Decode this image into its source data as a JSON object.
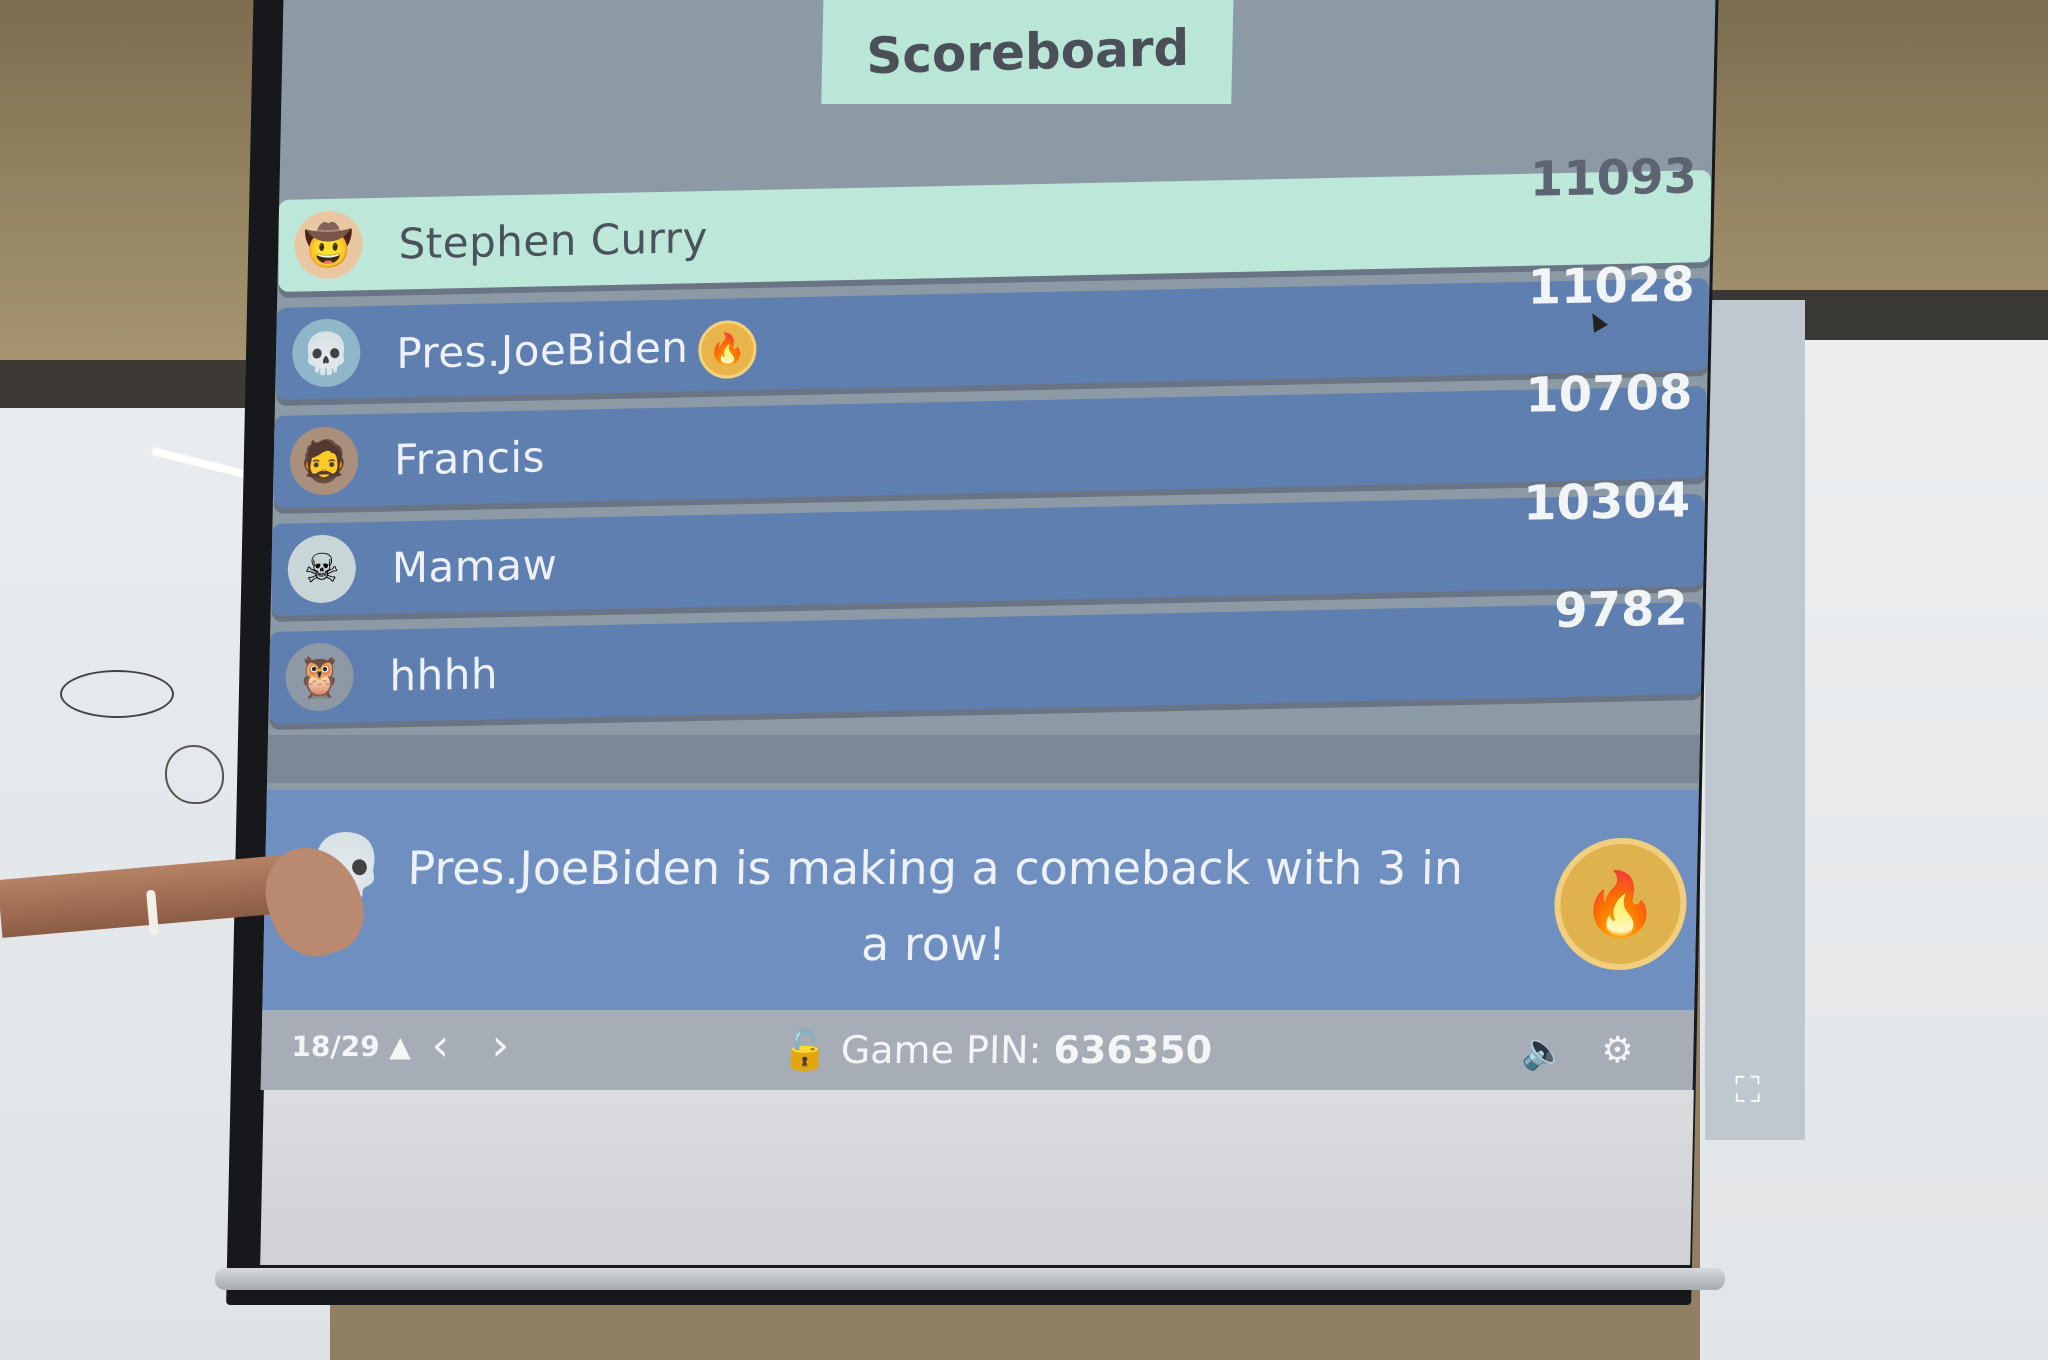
{
  "app": {
    "title": "Scoreboard"
  },
  "scoreboard": {
    "rows": [
      {
        "name": "Stephen Curry",
        "score": "11093",
        "avatar": "sombrero-emoji",
        "streak": false
      },
      {
        "name": "Pres.JoeBiden",
        "score": "11028",
        "avatar": "skull-tophat-emoji",
        "streak": true
      },
      {
        "name": "Francis",
        "score": "10708",
        "avatar": "bearded-face-emoji",
        "streak": false
      },
      {
        "name": "Mamaw",
        "score": "10304",
        "avatar": "skull-hat-emoji",
        "streak": false
      },
      {
        "name": "hhhh",
        "score": "9782",
        "avatar": "owl-emoji",
        "streak": false
      }
    ]
  },
  "banner": {
    "message": "Pres.JoeBiden is making a comeback with 3 in a row!",
    "avatar": "skull-tophat-emoji",
    "badge_icon": "fire-icon"
  },
  "footer": {
    "progress": "18/29",
    "progress_caret": "▲",
    "prev_label": "‹",
    "next_label": "›",
    "pin_label": "Game PIN:",
    "pin_value": "636350",
    "lock_icon": "🔓",
    "sound_icon": "🔈",
    "settings_icon": "⚙",
    "fullscreen_icon": "⛶"
  },
  "colors": {
    "highlight_row": "#bde7d9",
    "row": "#5f7fb0",
    "banner": "#6f8fc0",
    "streak_badge": "#e0b24d"
  }
}
